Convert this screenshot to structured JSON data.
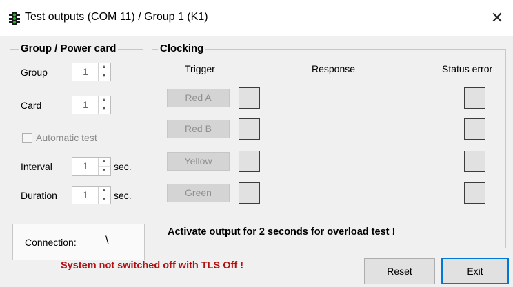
{
  "window": {
    "title": "Test outputs (COM 11) / Group 1 (K1)",
    "close_glyph": "✕"
  },
  "group_power": {
    "heading": "Group / Power card",
    "group_label": "Group",
    "group_value": "1",
    "card_label": "Card",
    "card_value": "1",
    "automatic_test_label": "Automatic test",
    "automatic_test_checked": false,
    "interval_label": "Interval",
    "interval_value": "1",
    "interval_unit": "sec.",
    "duration_label": "Duration",
    "duration_value": "1",
    "duration_unit": "sec."
  },
  "clocking": {
    "heading": "Clocking",
    "col_trigger": "Trigger",
    "col_response": "Response",
    "col_status_error": "Status error",
    "rows": [
      {
        "trigger": "Red A"
      },
      {
        "trigger": "Red B"
      },
      {
        "trigger": "Yellow"
      },
      {
        "trigger": "Green"
      }
    ],
    "note": "Activate output for 2 seconds for overload test !"
  },
  "connection": {
    "label": "Connection:",
    "indicator": "\\"
  },
  "footer": {
    "warning": "System not switched off with TLS Off !",
    "warning_color": "#b01010",
    "reset_label": "Reset",
    "exit_label": "Exit"
  },
  "colors": {
    "background": "#f0f0f0",
    "exit_border": "#0078d7"
  }
}
